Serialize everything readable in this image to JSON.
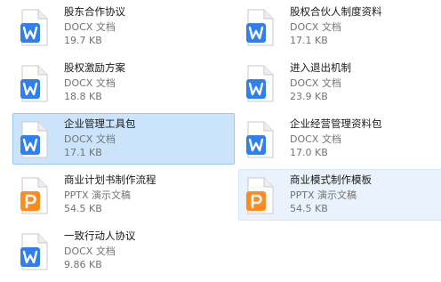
{
  "colors": {
    "docx_badge": "#2f7ff0",
    "pptx_badge": "#ff8a1f",
    "selected_bg": "#cce4fb",
    "hover_bg": "#eaf3fd"
  },
  "files": [
    {
      "name": "股东合作协议",
      "type": "DOCX 文档",
      "size": "19.7 KB",
      "icon": "word-doc-icon"
    },
    {
      "name": "股权合伙人制度资料",
      "type": "DOCX 文档",
      "size": "17.1 KB",
      "icon": "word-doc-icon"
    },
    {
      "name": "股权激励方案",
      "type": "DOCX 文档",
      "size": "18.8 KB",
      "icon": "word-doc-icon"
    },
    {
      "name": "进入退出机制",
      "type": "DOCX 文档",
      "size": "23.9 KB",
      "icon": "word-doc-icon"
    },
    {
      "name": "企业管理工具包",
      "type": "DOCX 文档",
      "size": "17.1 KB",
      "icon": "word-doc-icon",
      "state": "selected"
    },
    {
      "name": "企业经营管理资料包",
      "type": "DOCX 文档",
      "size": "17.0 KB",
      "icon": "word-doc-icon"
    },
    {
      "name": "商业计划书制作流程",
      "type": "PPTX 演示文稿",
      "size": "54.5 KB",
      "icon": "ppt-doc-icon"
    },
    {
      "name": "商业模式制作模板",
      "type": "PPTX 演示文稿",
      "size": "54.5 KB",
      "icon": "ppt-doc-icon",
      "state": "hover"
    },
    {
      "name": "一致行动人协议",
      "type": "DOCX 文档",
      "size": "9.86 KB",
      "icon": "word-doc-icon"
    }
  ]
}
